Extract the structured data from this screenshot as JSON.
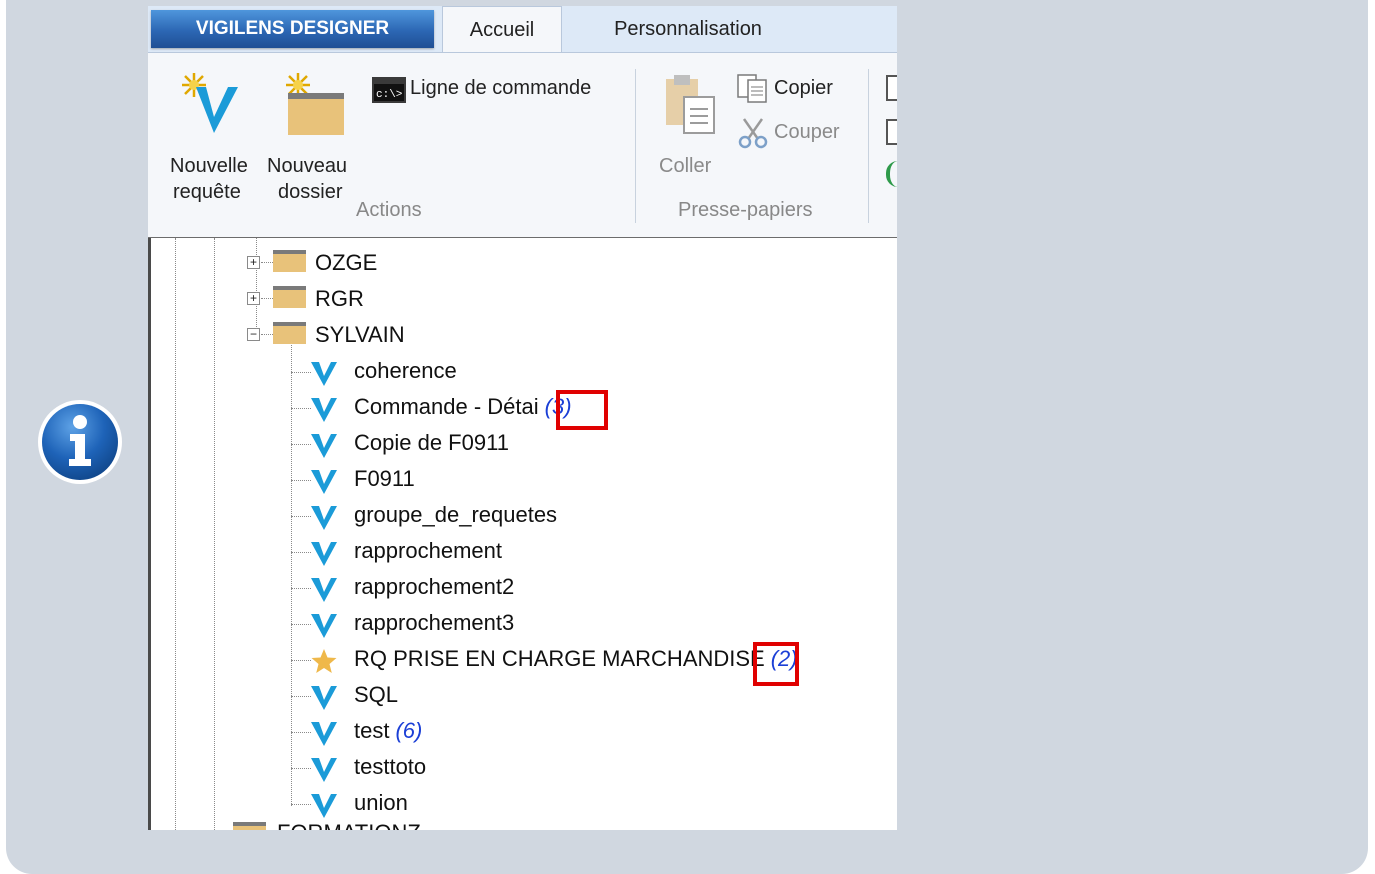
{
  "app": {
    "title": "VIGILENS DESIGNER",
    "tabs": [
      "Accueil",
      "Personnalisation"
    ],
    "active_tab": "Accueil"
  },
  "ribbon": {
    "actions": {
      "group_label": "Actions",
      "new_query_line1": "Nouvelle",
      "new_query_line2": "requête",
      "new_folder_line1": "Nouveau",
      "new_folder_line2": "dossier",
      "command_line": "Ligne de commande"
    },
    "clipboard": {
      "group_label": "Presse-papiers",
      "paste": "Coller",
      "copy": "Copier",
      "cut": "Couper"
    }
  },
  "tree": {
    "folders": [
      {
        "label": "OZGE",
        "expanded": false
      },
      {
        "label": "RGR",
        "expanded": false
      },
      {
        "label": "SYLVAIN",
        "expanded": true
      }
    ],
    "items": [
      {
        "label": "coherence",
        "count": "",
        "icon": "vigilens-v-icon"
      },
      {
        "label": "Commande - Détai",
        "count": "(3)",
        "icon": "vigilens-v-icon",
        "highlighted": true
      },
      {
        "label": "Copie de F0911",
        "count": "",
        "icon": "vigilens-v-icon"
      },
      {
        "label": "F0911",
        "count": "",
        "icon": "vigilens-v-icon"
      },
      {
        "label": "groupe_de_requetes",
        "count": "",
        "icon": "vigilens-v-icon"
      },
      {
        "label": "rapprochement",
        "count": "",
        "icon": "vigilens-v-icon"
      },
      {
        "label": "rapprochement2",
        "count": "",
        "icon": "vigilens-v-icon"
      },
      {
        "label": "rapprochement3",
        "count": "",
        "icon": "vigilens-v-icon"
      },
      {
        "label": "RQ PRISE EN CHARGE MARCHANDISE",
        "count": "(2)",
        "icon": "star-icon",
        "highlighted": true
      },
      {
        "label": "SQL",
        "count": "",
        "icon": "vigilens-v-icon"
      },
      {
        "label": "test",
        "count": "(6)",
        "icon": "vigilens-v-icon"
      },
      {
        "label": "testtoto",
        "count": "",
        "icon": "vigilens-v-icon"
      },
      {
        "label": "union",
        "count": "",
        "icon": "vigilens-v-icon"
      }
    ],
    "partial_folder": "FORMATIONZ"
  },
  "colors": {
    "panel_bg": "#d0d7e0",
    "info_blue": "#1e63b8",
    "highlight_red": "#e00000",
    "count_blue": "#1b3fd6",
    "folder_tan": "#e8c27a"
  }
}
